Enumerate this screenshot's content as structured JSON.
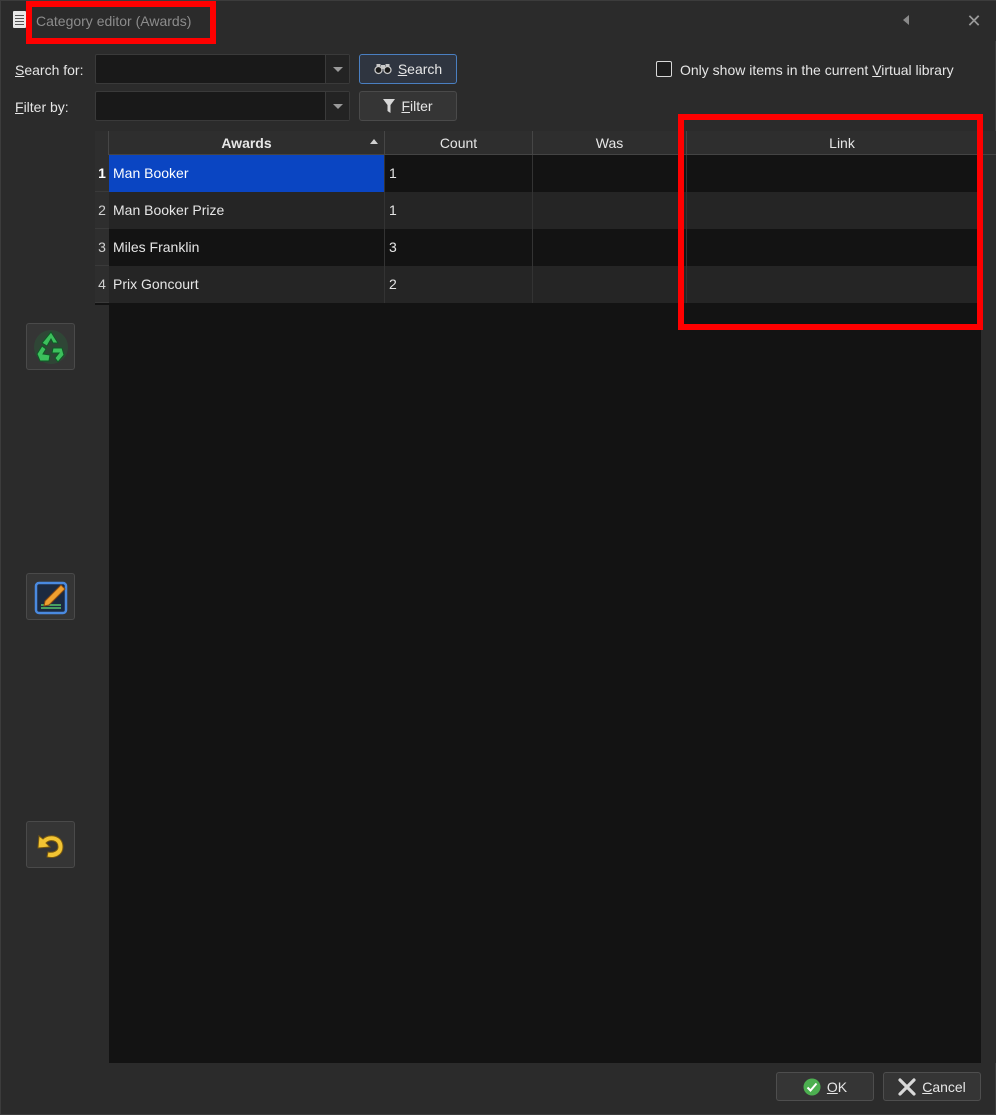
{
  "window": {
    "title": "Category editor (Awards)",
    "close_symbol": "✕"
  },
  "search": {
    "label_prefix": "S",
    "label_rest": "earch for:",
    "value": "",
    "button_prefix": "S",
    "button_rest": "earch",
    "button_icon": "binoculars-icon"
  },
  "filter": {
    "label_prefix": "F",
    "label_rest": "ilter by:",
    "value": "",
    "button_prefix": "F",
    "button_rest": "ilter",
    "button_icon": "funnel-icon"
  },
  "virtual_library": {
    "label_before": "Only show items in the current ",
    "label_underlined": "V",
    "label_after": "irtual library",
    "checked": false
  },
  "table": {
    "columns": [
      {
        "label": "Awards",
        "sorted": "ascending"
      },
      {
        "label": "Count"
      },
      {
        "label": "Was"
      },
      {
        "label": "Link"
      }
    ],
    "rows": [
      {
        "num": "1",
        "awards": "Man Booker",
        "count": "1",
        "was": "",
        "link": "",
        "selected": true
      },
      {
        "num": "2",
        "awards": "Man Booker Prize",
        "count": "1",
        "was": "",
        "link": ""
      },
      {
        "num": "3",
        "awards": "Miles Franklin",
        "count": "3",
        "was": "",
        "link": ""
      },
      {
        "num": "4",
        "awards": "Prix Goncourt",
        "count": "2",
        "was": "",
        "link": ""
      }
    ]
  },
  "side_buttons": [
    {
      "icon": "recycle-icon",
      "tooltip_name": "delete"
    },
    {
      "icon": "edit-pencil-icon",
      "tooltip_name": "rename"
    },
    {
      "icon": "undo-icon",
      "tooltip_name": "undo"
    }
  ],
  "footer": {
    "ok_prefix": "O",
    "ok_rest": "K",
    "cancel_prefix": "C",
    "cancel_rest": "ancel"
  },
  "colors": {
    "selection": "#0a45c2",
    "highlight_annotation": "#ff0000"
  }
}
